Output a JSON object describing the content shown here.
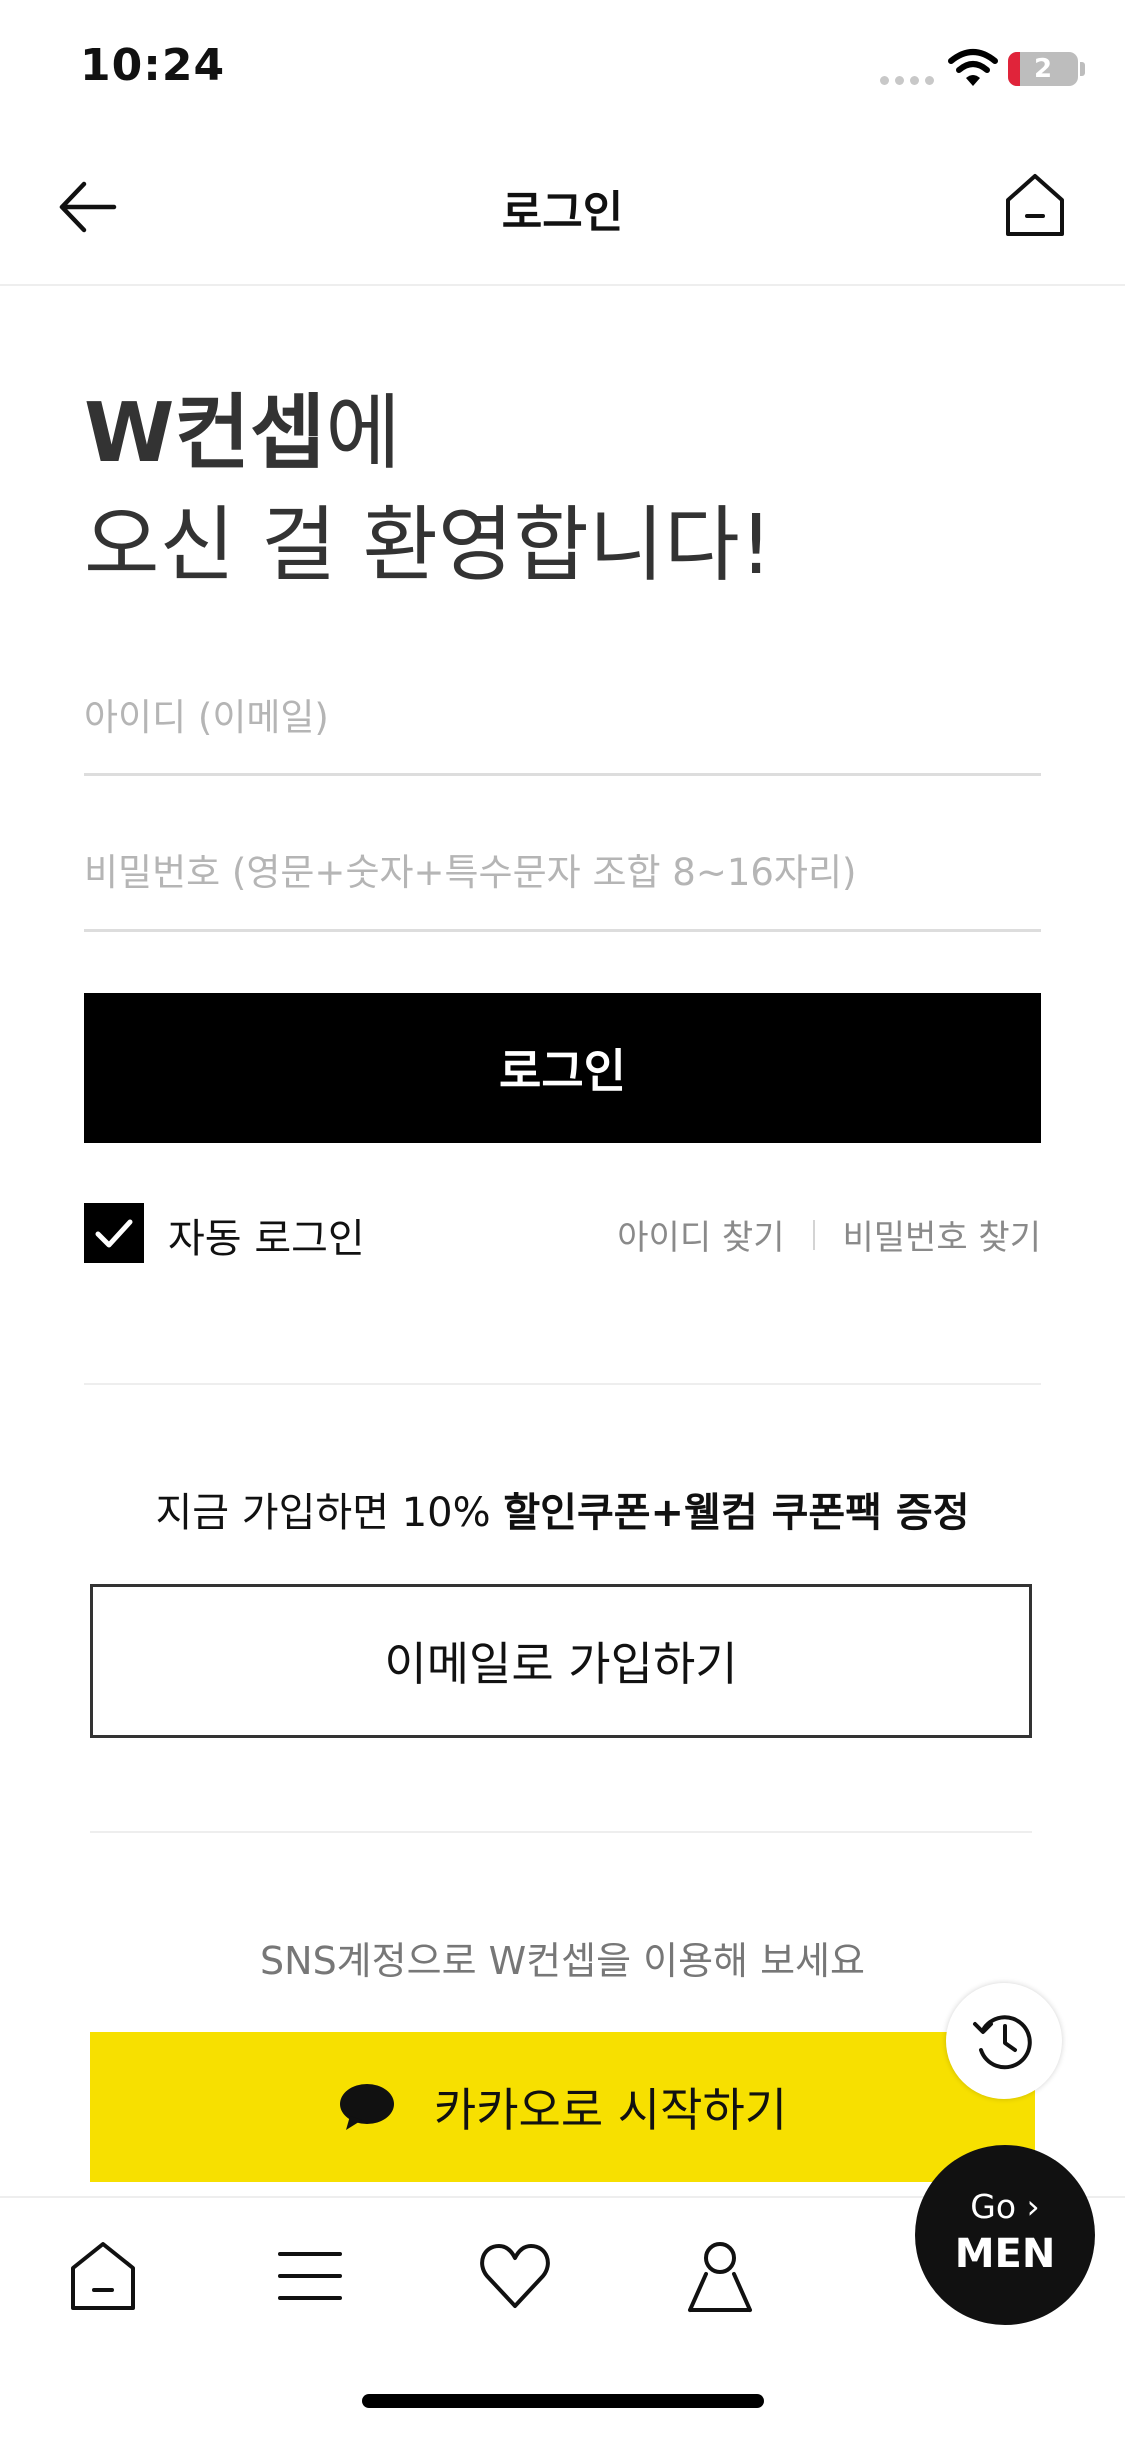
{
  "status_bar": {
    "time": "10:24",
    "battery": "2"
  },
  "header": {
    "title": "로그인"
  },
  "welcome": {
    "brand": "W컨셉",
    "line1_suffix": "에",
    "line2": "오신 걸 환영합니다!"
  },
  "form": {
    "id_placeholder": "아이디 (이메일)",
    "password_placeholder": "비밀번호 (영문+숫자+특수문자 조합 8~16자리)",
    "login_label": "로그인",
    "auto_login_label": "자동 로그인",
    "auto_login_checked": true,
    "find_id_label": "아이디 찾기",
    "find_password_label": "비밀번호 찾기"
  },
  "promo": {
    "prefix": "지금 가입하면 10% ",
    "highlight": "할인쿠폰+웰컴 쿠폰팩 증정"
  },
  "signup": {
    "email_label": "이메일로 가입하기"
  },
  "sns": {
    "text": "SNS계정으로 W컨셉을 이용해 보세요",
    "kakao_label": "카카오로 시작하기"
  },
  "floating": {
    "go_label": "Go",
    "men_label": "MEN"
  },
  "icons": {
    "back": "arrow-left-icon",
    "home": "home-icon",
    "history": "history-icon",
    "kakao": "speech-bubble-icon",
    "tab_home": "home-icon",
    "tab_menu": "menu-icon",
    "tab_like": "heart-icon",
    "tab_my": "user-icon"
  },
  "colors": {
    "primary": "#000000",
    "kakao": "#f7e000",
    "battery_low": "#e0243a"
  }
}
